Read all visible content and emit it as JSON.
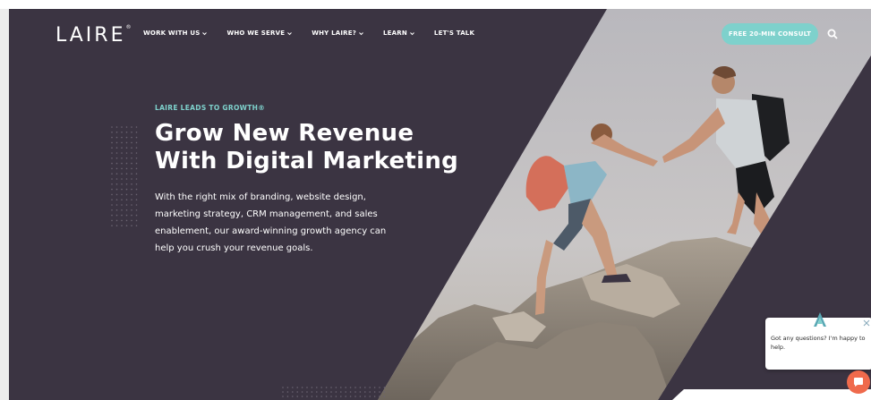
{
  "header": {
    "logo": "LAIRE",
    "nav": [
      {
        "label": "WORK WITH US",
        "has_dropdown": true
      },
      {
        "label": "WHO WE SERVE",
        "has_dropdown": true
      },
      {
        "label": "WHY LAIRE?",
        "has_dropdown": true
      },
      {
        "label": "LEARN",
        "has_dropdown": true
      },
      {
        "label": "LET'S TALK",
        "has_dropdown": false
      }
    ],
    "cta_label": "FREE 20-MIN CONSULT",
    "search_icon": "search-icon"
  },
  "hero": {
    "eyebrow": "LAIRE LEADS TO GROWTH®",
    "headline_line1": "Grow New Revenue",
    "headline_line2": "With Digital Marketing",
    "body": "With the right mix of branding, website design, marketing strategy, CRM management, and sales enablement, our award-winning growth agency can help you crush your revenue goals."
  },
  "chat": {
    "message": "Got any questions? I'm happy to help.",
    "close_icon": "close-icon",
    "launcher_icon": "chat-bubble-icon"
  },
  "colors": {
    "background": "#3b3442",
    "accent": "#7ed1cc",
    "chat_button": "#ef6a4c",
    "text": "#ffffff"
  }
}
